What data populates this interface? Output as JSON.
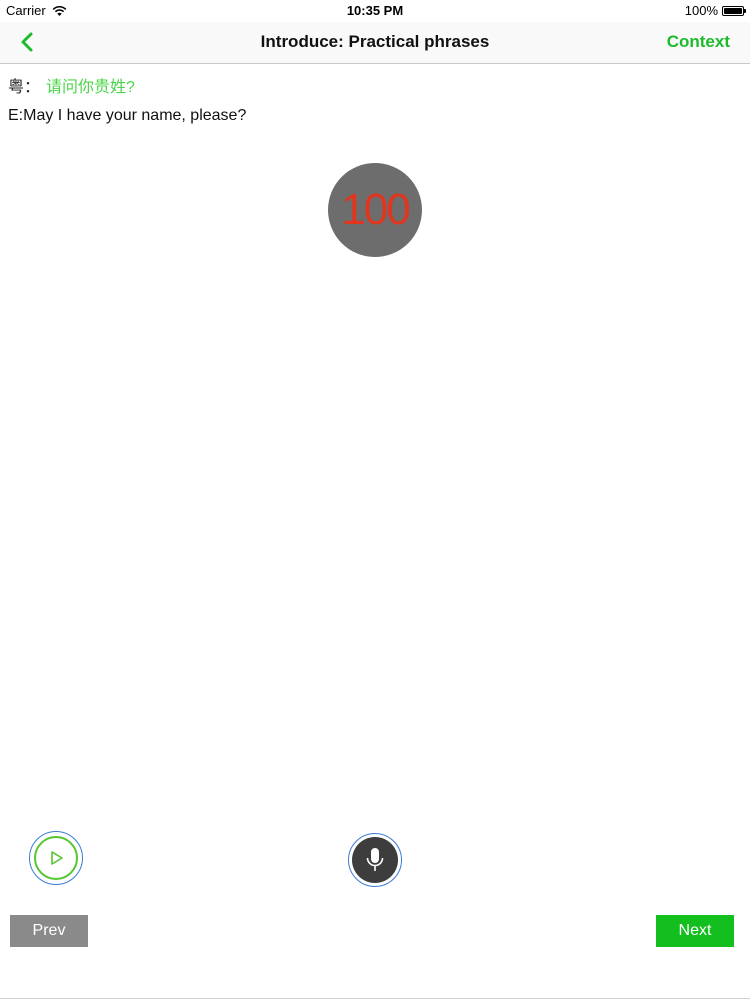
{
  "status_bar": {
    "carrier": "Carrier",
    "time": "10:35 PM",
    "battery": "100%",
    "battery_level": 1.0
  },
  "nav": {
    "title": "Introduce: Practical phrases",
    "back_icon": "chevron-left-icon",
    "context_label": "Context"
  },
  "phrase": {
    "cantonese_prefix": "粤：",
    "cantonese_text": "请问你贵姓?",
    "english_text": "E:May I have your name, please?"
  },
  "score": {
    "value": "100"
  },
  "controls": {
    "play_icon": "play-icon",
    "mic_icon": "microphone-icon",
    "prev_label": "Prev",
    "next_label": "Next"
  },
  "colors": {
    "accent_green": "#1dbb2c",
    "phrase_green": "#4cd44a",
    "score_red": "#e0351e",
    "score_bg": "#6d6d6d",
    "prev_bg": "#8a8a8a",
    "next_bg": "#12bf1f"
  }
}
